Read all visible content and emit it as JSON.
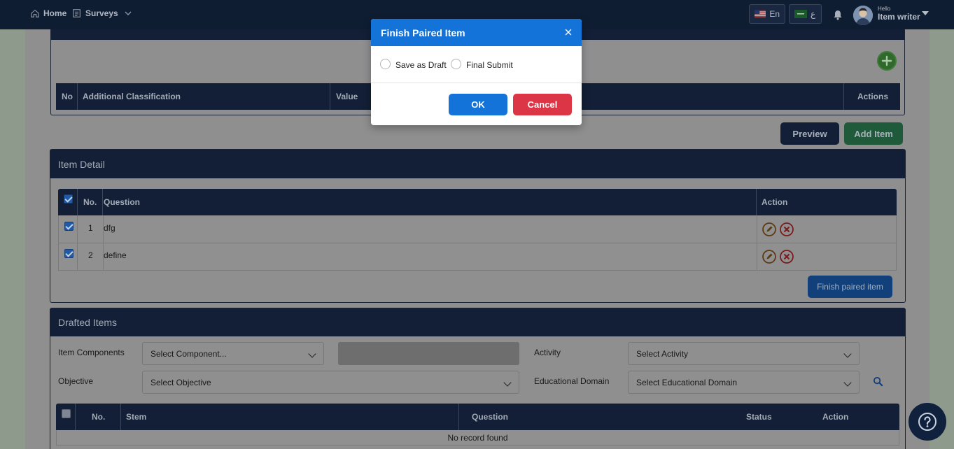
{
  "nav": {
    "home_label": "Home",
    "surveys_label": "Surveys",
    "lang_en": "En",
    "lang_ar": "ع",
    "user_hello": "Hello",
    "user_name": "Item writer"
  },
  "classification": {
    "columns": [
      "No",
      "Additional Classification",
      "Value",
      "Actions"
    ]
  },
  "buttons": {
    "preview": "Preview",
    "add_item": "Add Item",
    "finish_paired": "Finish paired item"
  },
  "item_detail": {
    "title": "Item Detail",
    "columns": [
      "No.",
      "Question",
      "Action"
    ],
    "rows": [
      {
        "no": "1",
        "question": "dfg"
      },
      {
        "no": "2",
        "question": "define"
      }
    ]
  },
  "drafted": {
    "title": "Drafted Items",
    "filters": {
      "item_components_label": "Item Components",
      "item_components_value": "Select Component...",
      "activity_label": "Activity",
      "activity_value": "Select Activity",
      "objective_label": "Objective",
      "objective_value": "Select Objective",
      "educational_domain_label": "Educational Domain",
      "educational_domain_value": "Select Educational Domain"
    },
    "columns": [
      "No.",
      "Stem",
      "Question",
      "Status",
      "Action"
    ],
    "empty_text": "No record found"
  },
  "modal": {
    "title": "Finish Paired Item",
    "option_draft": "Save as Draft",
    "option_final": "Final Submit",
    "ok": "OK",
    "cancel": "Cancel"
  },
  "colors": {
    "navbar": "#0f1d33",
    "modal_header": "#1473d8",
    "ok_button": "#1473d8",
    "cancel_button": "#dc3545",
    "add_item_button": "#1e5a3a"
  }
}
